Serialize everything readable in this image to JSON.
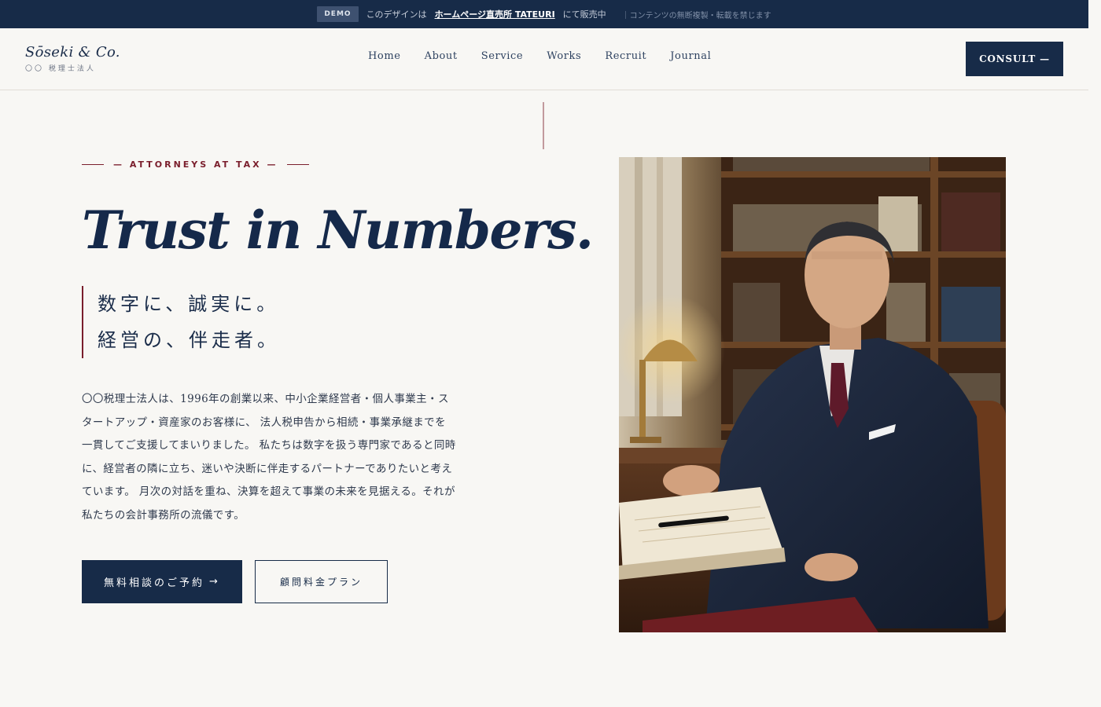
{
  "demo_bar": {
    "badge": "DEMO",
    "text_before": "このデザインは",
    "link": "ホームページ直売所 TATEURI",
    "text_after": "にて販売中",
    "note": "｜コンテンツの無断複製・転載を禁じます"
  },
  "header": {
    "logo_main": "Sōseki & Co.",
    "logo_sub": "〇〇 税理士法人",
    "nav": [
      "Home",
      "About",
      "Service",
      "Works",
      "Recruit",
      "Journal"
    ],
    "consult_label": "CONSULT —"
  },
  "hero": {
    "eyebrow": "— ATTORNEYS AT TAX —",
    "title": "Trust in Numbers.",
    "lead_line1": "数字に、誠実に。",
    "lead_line2": "経営の、伴走者。",
    "body": "〇〇税理士法人は、1996年の創業以来、中小企業経営者・個人事業主・スタートアップ・資産家のお客様に、 法人税申告から相続・事業承継までを一貫してご支援してまいりました。 私たちは数字を扱う専門家であると同時に、経営者の隣に立ち、迷いや決断に伴走するパートナーでありたいと考えています。 月次の対話を重ね、決算を超えて事業の未来を見据える。それが私たちの会計事務所の流儀です。",
    "primary_button": "無料相談のご予約",
    "primary_arrow": "→",
    "secondary_button": "顧問料金プラン"
  },
  "colors": {
    "navy": "#172b48",
    "burgundy": "#7a1e2c",
    "background": "#f8f7f4"
  }
}
